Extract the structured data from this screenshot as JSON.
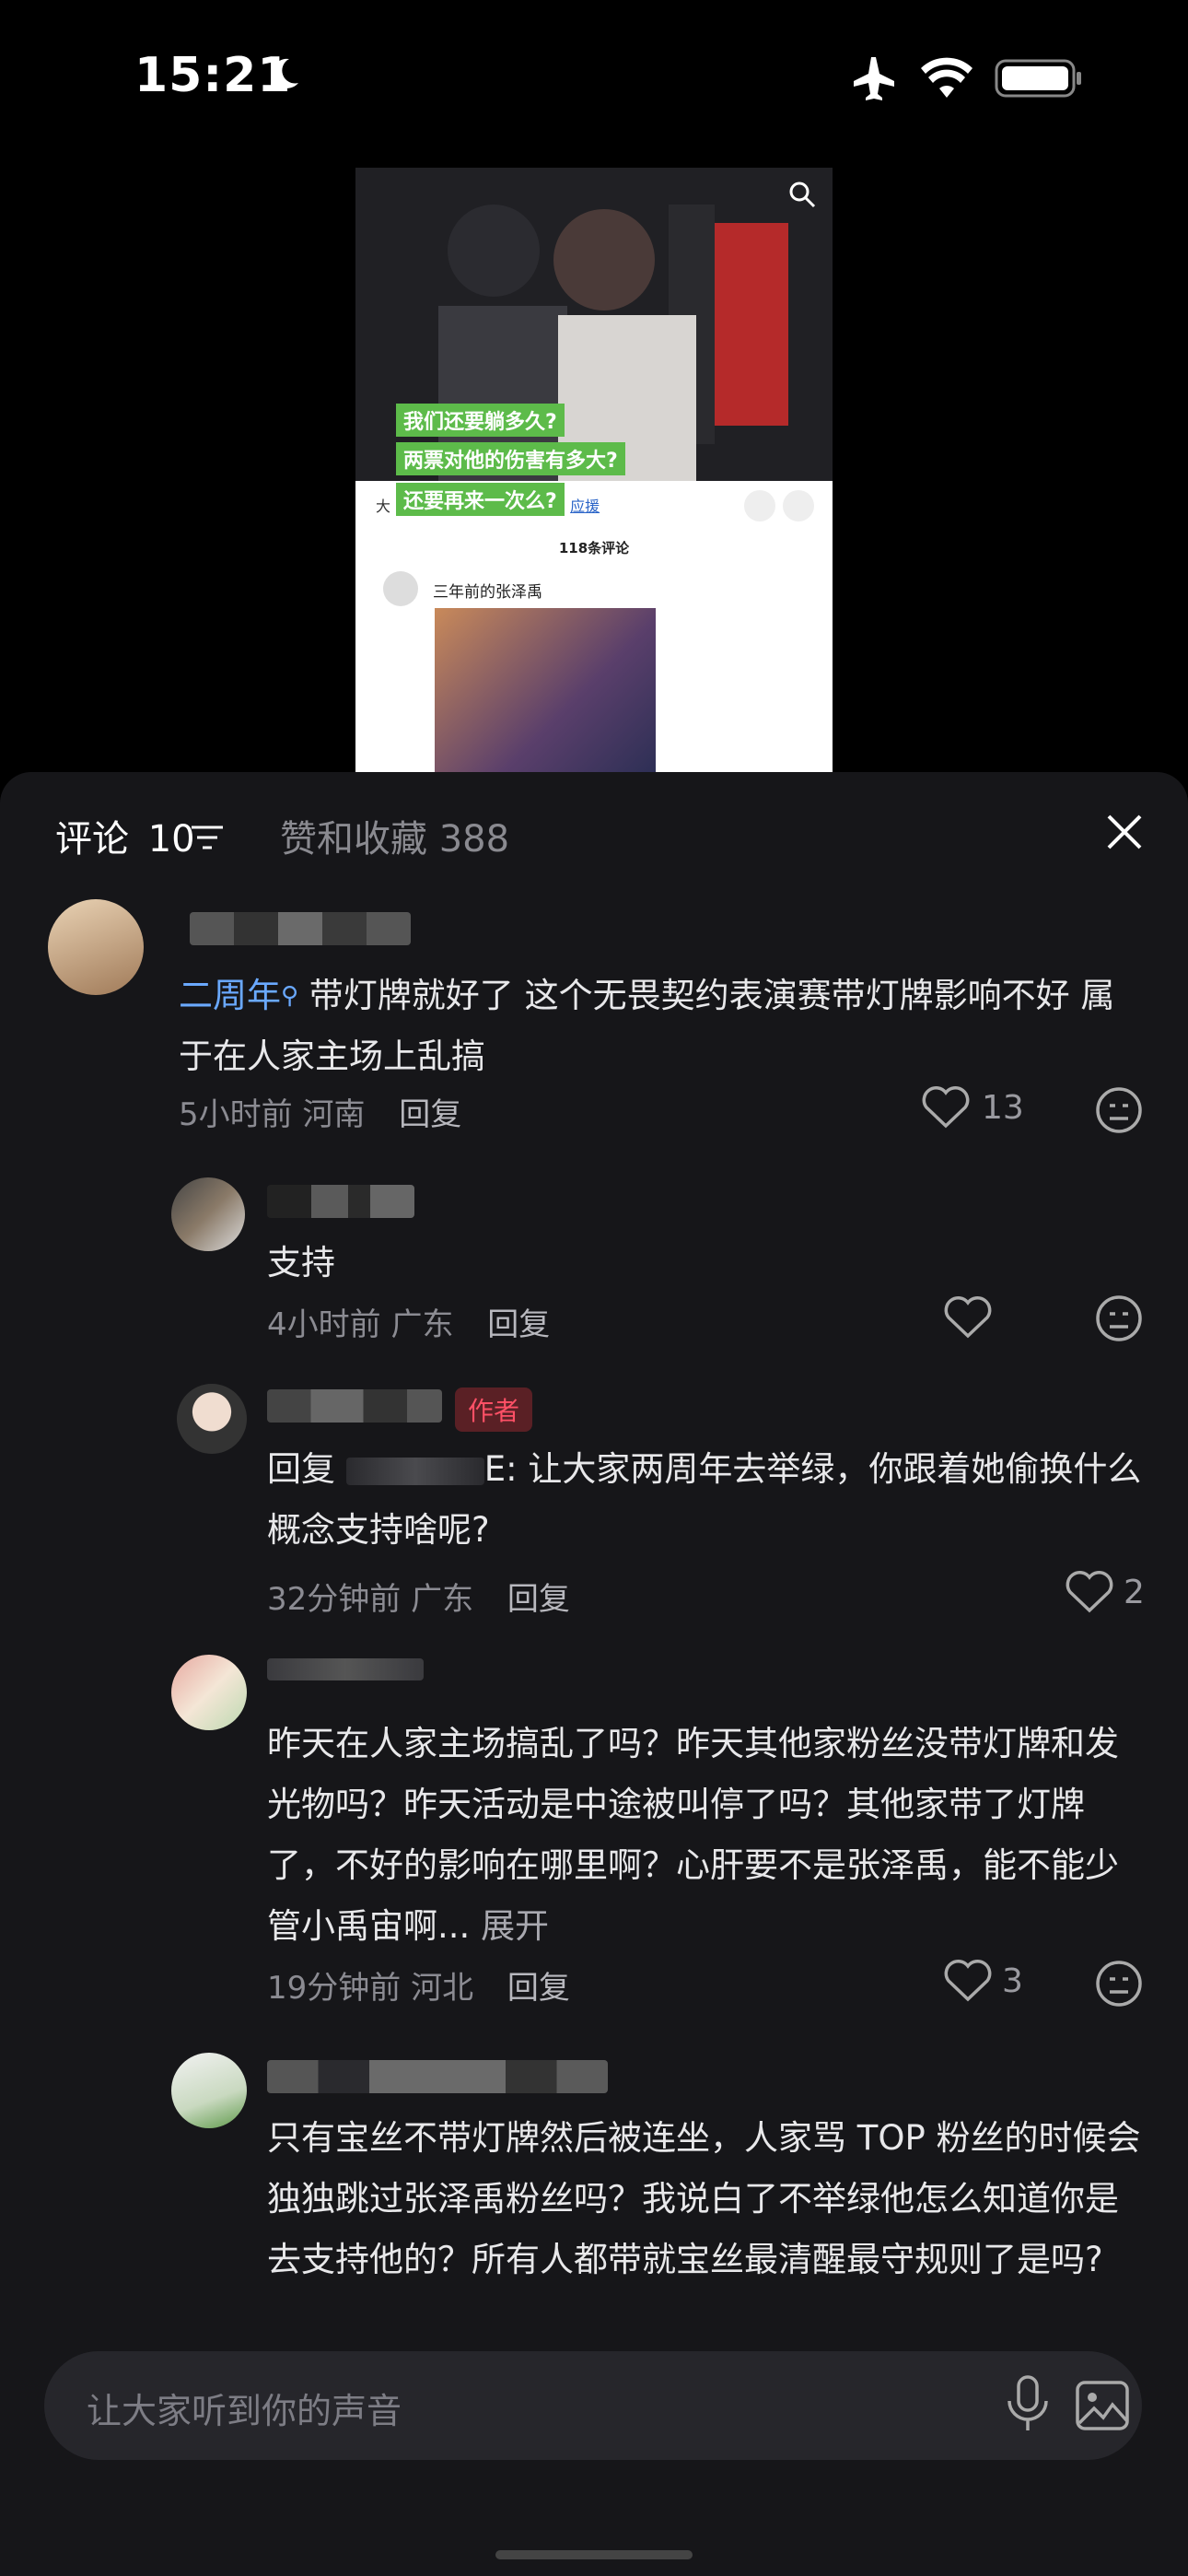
{
  "status": {
    "time": "15:21"
  },
  "video": {
    "captions": [
      "我们还要躺多久?",
      "两票对他的伤害有多大?",
      "还要再来一次么?"
    ]
  },
  "popup": {
    "tab_left": "大",
    "tab_right": "应援",
    "count": "118条评论",
    "user": "三年前的张泽禹"
  },
  "tabs": {
    "comment_label": "评论",
    "comment_count": "10",
    "likes_label": "赞和收藏 388"
  },
  "comments": [
    {
      "topic": "二周年",
      "text": "带灯牌就好了 这个无畏契约表演赛带灯牌影响不好 属于在人家主场上乱搞",
      "time": "5小时前",
      "location": "河南",
      "reply": "回复",
      "likes": "13"
    },
    {
      "text": "支持",
      "time": "4小时前",
      "location": "广东",
      "reply": "回复",
      "likes": ""
    },
    {
      "badge": "作者",
      "text_prefix": "回复",
      "text_tail": "E: 让大家两周年去举绿，你跟着她偷换什么概念支持啥呢?",
      "time": "32分钟前",
      "location": "广东",
      "reply": "回复",
      "likes": "2"
    },
    {
      "text": "昨天在人家主场搞乱了吗？昨天其他家粉丝没带灯牌和发光物吗？昨天活动是中途被叫停了吗？其他家带了灯牌了，不好的影响在哪里啊？心肝要不是张泽禹，能不能少管小禹宙啊",
      "ellipsis": "...",
      "expand": "展开",
      "time": "19分钟前",
      "location": "河北",
      "reply": "回复",
      "likes": "3"
    },
    {
      "text": "只有宝丝不带灯牌然后被连坐，人家骂 TOP 粉丝的时候会独独跳过张泽禹粉丝吗？我说白了不举绿他怎么知道你是去支持他的？所有人都带就宝丝最清醒最守规则了是吗?"
    }
  ],
  "input": {
    "placeholder": "让大家听到你的声音"
  }
}
